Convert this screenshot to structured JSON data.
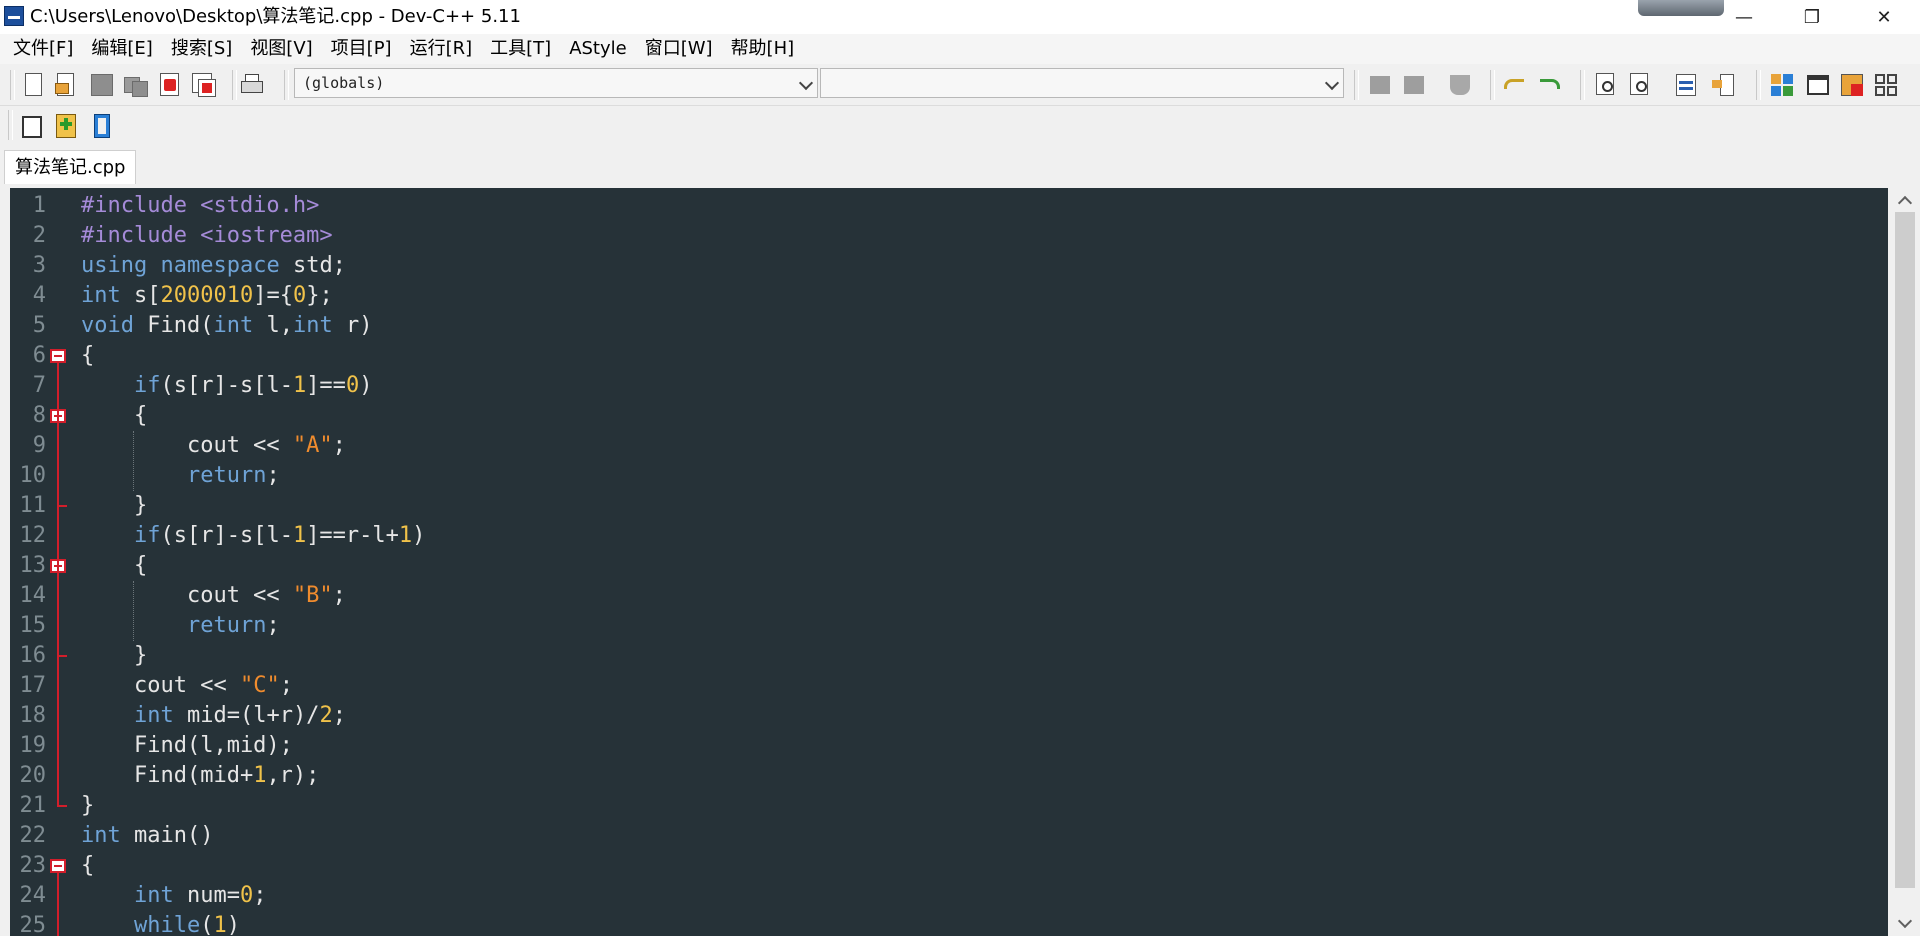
{
  "window": {
    "title": "C:\\Users\\Lenovo\\Desktop\\算法笔记.cpp - Dev-C++ 5.11",
    "minimize_glyph": "—",
    "maximize_glyph": "❐",
    "close_glyph": "✕"
  },
  "menu": [
    "文件[F]",
    "编辑[E]",
    "搜索[S]",
    "视图[V]",
    "项目[P]",
    "运行[R]",
    "工具[T]",
    "AStyle",
    "窗口[W]",
    "帮助[H]"
  ],
  "toolbar": {
    "globals_combo": "(globals)",
    "functions_combo": ""
  },
  "tab": {
    "filename": "算法笔记.cpp"
  },
  "editor": {
    "line_numbers": [
      "1",
      "2",
      "3",
      "4",
      "5",
      "6",
      "7",
      "8",
      "9",
      "10",
      "11",
      "12",
      "13",
      "14",
      "15",
      "16",
      "17",
      "18",
      "19",
      "20",
      "21",
      "22",
      "23",
      "24",
      "25"
    ],
    "lines": [
      [
        {
          "t": "#include <stdio.h>",
          "c": "pp"
        }
      ],
      [
        {
          "t": "#include <iostream>",
          "c": "pp"
        }
      ],
      [
        {
          "t": "using",
          "c": "kw"
        },
        {
          "t": " "
        },
        {
          "t": "namespace",
          "c": "kw"
        },
        {
          "t": " std;"
        }
      ],
      [
        {
          "t": "int",
          "c": "kw"
        },
        {
          "t": " s["
        },
        {
          "t": "2000010",
          "c": "num"
        },
        {
          "t": "]={"
        },
        {
          "t": "0",
          "c": "num"
        },
        {
          "t": "};"
        }
      ],
      [
        {
          "t": "void",
          "c": "kw"
        },
        {
          "t": " Find("
        },
        {
          "t": "int",
          "c": "kw"
        },
        {
          "t": " l,"
        },
        {
          "t": "int",
          "c": "kw"
        },
        {
          "t": " r)"
        }
      ],
      [
        {
          "t": "{"
        }
      ],
      [
        {
          "t": "    "
        },
        {
          "t": "if",
          "c": "kw"
        },
        {
          "t": "(s[r]-s[l-"
        },
        {
          "t": "1",
          "c": "num"
        },
        {
          "t": "]=="
        },
        {
          "t": "0",
          "c": "num"
        },
        {
          "t": ")"
        }
      ],
      [
        {
          "t": "    {"
        }
      ],
      [
        {
          "t": "        cout << "
        },
        {
          "t": "\"A\"",
          "c": "str"
        },
        {
          "t": ";"
        }
      ],
      [
        {
          "t": "        "
        },
        {
          "t": "return",
          "c": "kw"
        },
        {
          "t": ";"
        }
      ],
      [
        {
          "t": "    }"
        }
      ],
      [
        {
          "t": "    "
        },
        {
          "t": "if",
          "c": "kw"
        },
        {
          "t": "(s[r]-s[l-"
        },
        {
          "t": "1",
          "c": "num"
        },
        {
          "t": "]==r-l+"
        },
        {
          "t": "1",
          "c": "num"
        },
        {
          "t": ")"
        }
      ],
      [
        {
          "t": "    {"
        }
      ],
      [
        {
          "t": "        cout << "
        },
        {
          "t": "\"B\"",
          "c": "str"
        },
        {
          "t": ";"
        }
      ],
      [
        {
          "t": "        "
        },
        {
          "t": "return",
          "c": "kw"
        },
        {
          "t": ";"
        }
      ],
      [
        {
          "t": "    }"
        }
      ],
      [
        {
          "t": "    cout << "
        },
        {
          "t": "\"C\"",
          "c": "str"
        },
        {
          "t": ";"
        }
      ],
      [
        {
          "t": "    "
        },
        {
          "t": "int",
          "c": "kw"
        },
        {
          "t": " mid=(l+r)/"
        },
        {
          "t": "2",
          "c": "num"
        },
        {
          "t": ";"
        }
      ],
      [
        {
          "t": "    Find(l,mid);"
        }
      ],
      [
        {
          "t": "    Find(mid+"
        },
        {
          "t": "1",
          "c": "num"
        },
        {
          "t": ",r);"
        }
      ],
      [
        {
          "t": "}"
        }
      ],
      [
        {
          "t": "int",
          "c": "kw"
        },
        {
          "t": " main()"
        }
      ],
      [
        {
          "t": "{"
        }
      ],
      [
        {
          "t": "    "
        },
        {
          "t": "int",
          "c": "kw"
        },
        {
          "t": " num="
        },
        {
          "t": "0",
          "c": "num"
        },
        {
          "t": ";"
        }
      ],
      [
        {
          "t": "    "
        },
        {
          "t": "while",
          "c": "kw"
        },
        {
          "t": "("
        },
        {
          "t": "1",
          "c": "num"
        },
        {
          "t": ")"
        }
      ]
    ]
  },
  "colors": {
    "editor_background": "#263238",
    "keyword": "#6fa3d6",
    "preprocessor": "#a58bd8",
    "number": "#f0c24a",
    "string": "#f08c2e",
    "fold_marker": "#d21e2b"
  },
  "icons": [
    "new-file-icon",
    "open-file-icon",
    "save-icon",
    "save-all-icon",
    "close-icon",
    "close-all-icon",
    "print-icon",
    "indent-icon",
    "unindent-icon",
    "toggle-comment-icon",
    "undo-icon",
    "redo-icon",
    "find-icon",
    "replace-icon",
    "goto-line-icon",
    "toggle-bookmark-icon",
    "tile-icon",
    "window-icon",
    "color-icon",
    "grid-icon",
    "new-project-icon",
    "add-to-project-icon",
    "remove-from-project-icon"
  ]
}
